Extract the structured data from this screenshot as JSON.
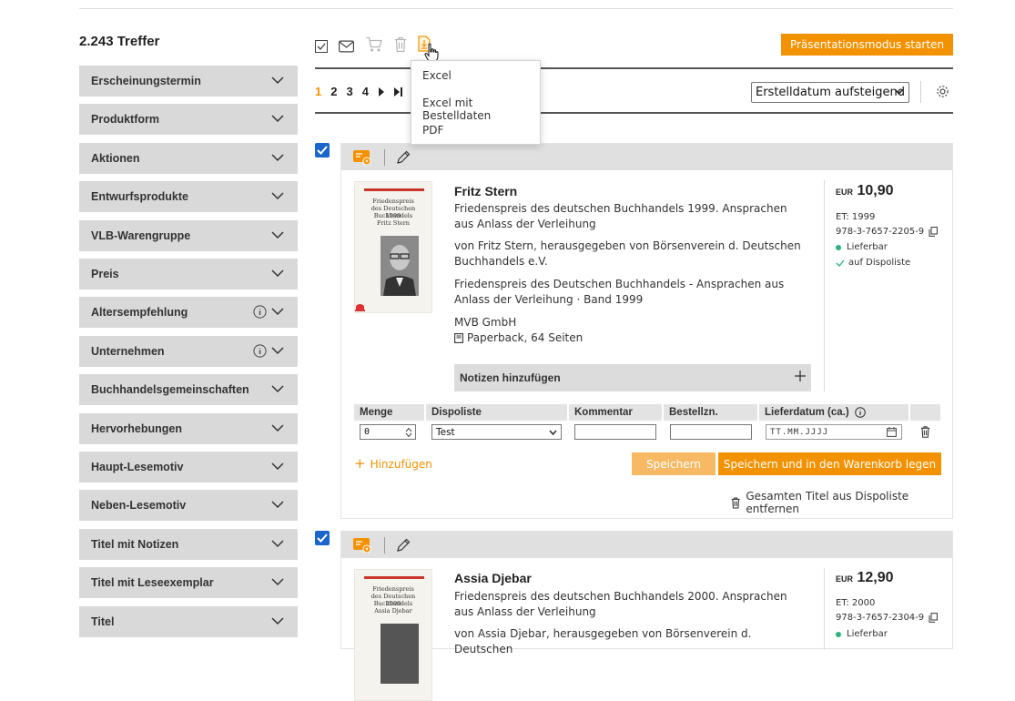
{
  "results": {
    "count_label": "2.243 Treffer"
  },
  "facets": [
    {
      "label": "Erscheinungstermin",
      "info": false
    },
    {
      "label": "Produktform",
      "info": false
    },
    {
      "label": "Aktionen",
      "info": false
    },
    {
      "label": "Entwurfsprodukte",
      "info": false
    },
    {
      "label": "VLB-Warengruppe",
      "info": false
    },
    {
      "label": "Preis",
      "info": false
    },
    {
      "label": "Altersempfehlung",
      "info": true
    },
    {
      "label": "Unternehmen",
      "info": true
    },
    {
      "label": "Buchhandelsgemeinschaften",
      "info": false
    },
    {
      "label": "Hervorhebungen",
      "info": false
    },
    {
      "label": "Haupt-Lesemotiv",
      "info": false
    },
    {
      "label": "Neben-Lesemotiv",
      "info": false
    },
    {
      "label": "Titel mit Notizen",
      "info": false
    },
    {
      "label": "Titel mit Leseexemplar",
      "info": false
    },
    {
      "label": "Titel",
      "info": false
    }
  ],
  "toolbar": {
    "icons": [
      "checkbox-icon",
      "mail-icon",
      "cart-icon",
      "trash-icon",
      "export-icon"
    ],
    "presentation_button": "Präsentationsmodus starten"
  },
  "export_menu": {
    "items": [
      "Excel",
      "Excel mit Bestelldaten",
      "PDF"
    ]
  },
  "pagination": {
    "pages": [
      "1",
      "2",
      "3",
      "4"
    ],
    "active": "1"
  },
  "sort": {
    "selected": "Erstelldatum aufsteigend"
  },
  "accent_color": "#f39200",
  "products": [
    {
      "cover": {
        "lines": [
          "Friedenspreis",
          "des Deutschen Buchhandels",
          "1999",
          "Fritz Stern"
        ]
      },
      "author": "Fritz Stern",
      "title": "Friedenspreis des deutschen Buchhandels 1999. Ansprachen aus Anlass der Verleihung",
      "contributors": "von Fritz Stern, herausgegeben von Börsenverein d. Deutschen Buchhandels e.V.",
      "series": "Friedenspreis des Deutschen Buchhandels - Ansprachen aus Anlass der Verleihung · Band 1999",
      "publisher": "MVB GmbH",
      "format": "Paperback, 64 Seiten",
      "currency": "EUR",
      "price": "10,90",
      "et": "ET: 1999",
      "isbn": "978-3-7657-2205-9",
      "availability": "Lieferbar",
      "dispo_status": "auf Dispoliste",
      "notes_label": "Notizen hinzufügen",
      "order": {
        "headers": [
          "Menge",
          "Dispoliste",
          "Kommentar",
          "Bestellzn.",
          "Lieferdatum (ca.)"
        ],
        "quantity": "0",
        "dispoliste": "Test",
        "date_placeholder": "TT.MM.JJJJ"
      },
      "add_link": "Hinzufügen",
      "save_button": "Speichern",
      "save_cart_button": "Speichern und in den Warenkorb legen",
      "remove_all": "Gesamten Titel aus Dispoliste entfernen"
    },
    {
      "cover": {
        "lines": [
          "Friedenspreis",
          "des Deutschen Buchhandels",
          "2000",
          "Assia Djebar"
        ]
      },
      "author": "Assia Djebar",
      "title": "Friedenspreis des deutschen Buchhandels 2000. Ansprachen aus Anlass der Verleihung",
      "contributors": "von Assia Djebar, herausgegeben von Börsenverein d. Deutschen",
      "currency": "EUR",
      "price": "12,90",
      "et": "ET: 2000",
      "isbn": "978-3-7657-2304-9",
      "availability": "Lieferbar"
    }
  ]
}
